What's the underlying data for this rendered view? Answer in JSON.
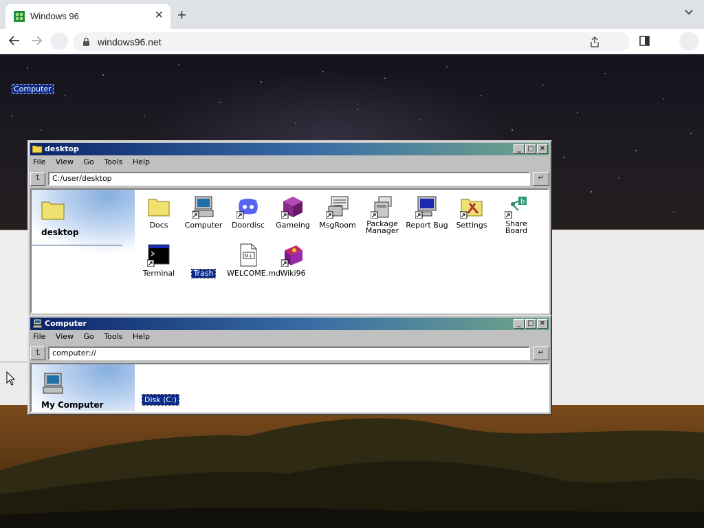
{
  "browser": {
    "tab_title": "Windows 96",
    "tab_close": "✕",
    "new_tab": "+",
    "url": "windows96.net"
  },
  "desktop": {
    "selected_icon_label": "Computer"
  },
  "win_desktop": {
    "title": "desktop",
    "menu": [
      "File",
      "View",
      "Go",
      "Tools",
      "Help"
    ],
    "address": "C:/user/desktop",
    "up_glyph": "⮤",
    "go_glyph": "↵",
    "side_title": "desktop",
    "items": [
      {
        "label": "Docs",
        "icon": "folder-icon"
      },
      {
        "label": "Computer",
        "icon": "computer-icon"
      },
      {
        "label": "Doordisc",
        "icon": "discord-icon"
      },
      {
        "label": "Gameing",
        "icon": "game-cube-icon"
      },
      {
        "label": "MsgRoom",
        "icon": "message-room-icon"
      },
      {
        "label": "Package Manager",
        "icon": "package-icon"
      },
      {
        "label": "Report Bug",
        "icon": "monitor-icon"
      },
      {
        "label": "Settings",
        "icon": "settings-folder-icon"
      },
      {
        "label": "Share Board",
        "icon": "share-board-icon"
      },
      {
        "label": "Terminal",
        "icon": "terminal-icon"
      },
      {
        "label": "Trash",
        "icon": "trash-icon"
      },
      {
        "label": "WELCOME.md",
        "icon": "markdown-file-icon"
      },
      {
        "label": "Wiki96",
        "icon": "wiki-book-icon"
      }
    ]
  },
  "win_computer": {
    "title": "Computer",
    "menu": [
      "File",
      "View",
      "Go",
      "Tools",
      "Help"
    ],
    "address": "computer://",
    "up_glyph": "⮤",
    "go_glyph": "↵",
    "side_title": "My Computer",
    "disk_label": "Disk (C:)"
  },
  "window_buttons": {
    "minimize": "_",
    "maximize": "□",
    "close": "✕"
  },
  "colors": {
    "titlebar_start": "#0a246a",
    "titlebar_end": "#6fa58a",
    "selection": "#0a2a8a",
    "win_face": "#c0c0c0"
  }
}
